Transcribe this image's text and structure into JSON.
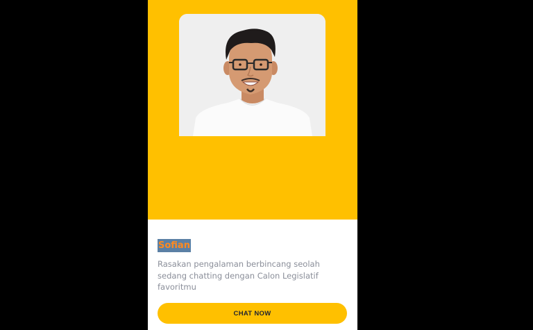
{
  "candidate": {
    "name": "Sofian",
    "description": "Rasakan pengalaman berbincang seolah sedang chatting dengan Calon Legislatif favoritmu",
    "photo_icon": "person-portrait-icon"
  },
  "actions": {
    "chat_label": "CHAT NOW"
  },
  "colors": {
    "background": "#000000",
    "card_background": "#ffffff",
    "hero_accent": "#ffc000",
    "name_text": "#ff8a1f",
    "name_highlight": "#5b80a5",
    "description_text": "#8a8e99",
    "button_text": "#1f2330"
  }
}
